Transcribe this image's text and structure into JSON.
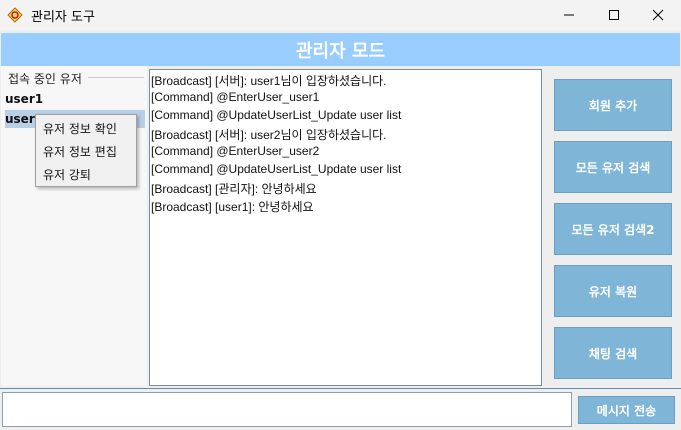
{
  "window": {
    "title": "관리자 도구",
    "colors": {
      "banner": "#99ccff",
      "button": "#7fb5d6",
      "selection": "#b8cfe5"
    }
  },
  "banner": {
    "title": "관리자 모드"
  },
  "user_panel": {
    "legend": "접속 중인 유저",
    "users": [
      "user1",
      "user2"
    ],
    "selected_user": "user2"
  },
  "context_menu": {
    "items": [
      "유저 정보 확인",
      "유저 정보 편집",
      "유저 강퇴"
    ]
  },
  "chat": {
    "lines": [
      "[Broadcast] [서버]: user1님이 입장하셨습니다.",
      "[Command] @EnterUser_user1",
      "[Command] @UpdateUserList_Update user list",
      "[Broadcast] [서버]: user2님이 입장하셨습니다.",
      "[Command] @EnterUser_user2",
      "[Command] @UpdateUserList_Update user list",
      "[Broadcast] [관리자]: 안녕하세요",
      "[Broadcast] [user1]: 안녕하세요"
    ]
  },
  "side_buttons": {
    "add_member": "회원 추가",
    "search_all_users": "모든 유저 검색",
    "search_all_users2": "모든 유저 검색2",
    "restore_user": "유저 복원",
    "search_chat": "채팅 검색"
  },
  "bottom": {
    "message_value": "",
    "send_label": "메시지 전송"
  },
  "icons": {
    "app": "app-logo-icon",
    "minimize": "minimize-icon",
    "maximize": "maximize-icon",
    "close": "close-icon"
  }
}
